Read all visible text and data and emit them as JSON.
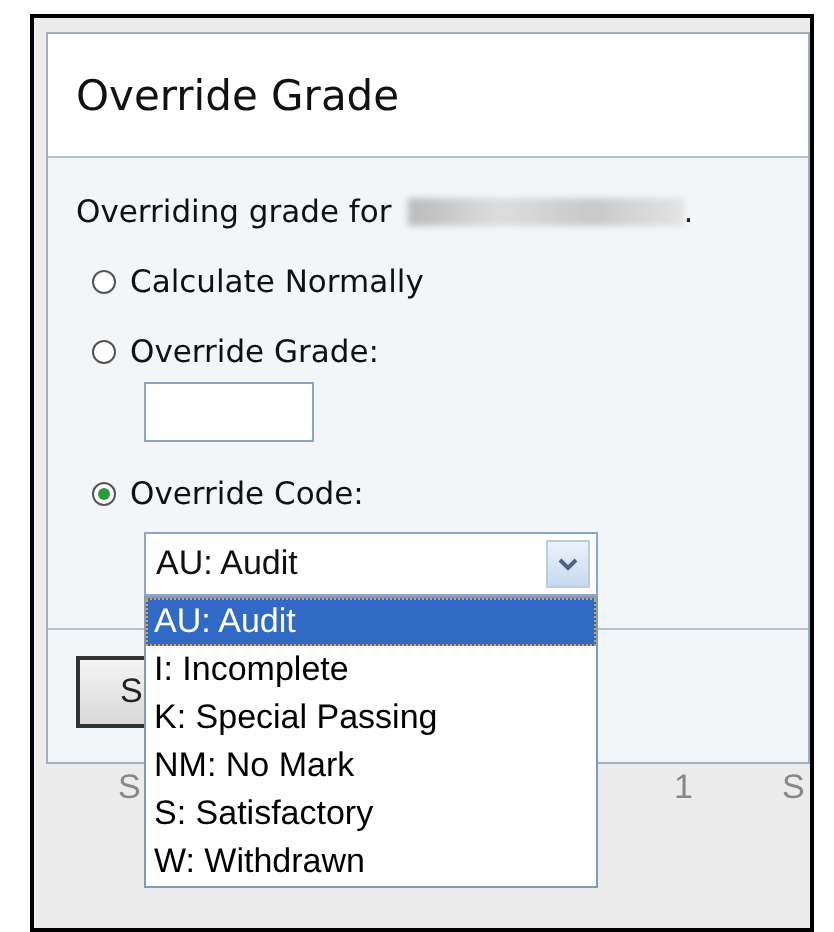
{
  "dialog": {
    "title": "Override Grade",
    "prompt": "Overriding grade for",
    "prompt_end": ".",
    "options": [
      {
        "label": "Calculate Normally",
        "selected": false,
        "kind": "plain"
      },
      {
        "label": "Override Grade:",
        "selected": false,
        "kind": "text"
      },
      {
        "label": "Override Code:",
        "selected": true,
        "kind": "select"
      }
    ],
    "code_select": {
      "value": "AU: Audit",
      "expanded": true,
      "options": [
        {
          "label": "AU: Audit",
          "selected": true
        },
        {
          "label": "I: Incomplete",
          "selected": false
        },
        {
          "label": "K: Special Passing",
          "selected": false
        },
        {
          "label": "NM: No Mark",
          "selected": false
        },
        {
          "label": "S: Satisfactory",
          "selected": false
        },
        {
          "label": "W: Withdrawn",
          "selected": false
        }
      ]
    },
    "footer_button": {
      "label": "S"
    }
  },
  "background": {
    "cells": [
      "S",
      "1",
      "S"
    ]
  }
}
